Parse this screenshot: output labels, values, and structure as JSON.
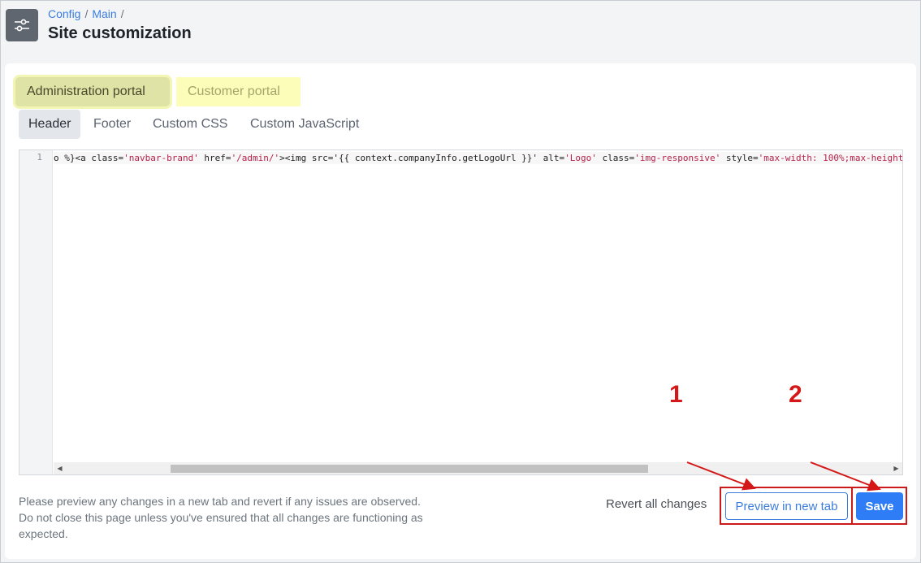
{
  "breadcrumb": {
    "items": [
      "Config",
      "Main"
    ],
    "separator": "/"
  },
  "page_title": "Site customization",
  "portal_tabs": [
    {
      "label": "Administration portal",
      "active": true
    },
    {
      "label": "Customer portal",
      "active": false
    }
  ],
  "section_tabs": [
    {
      "label": "Header",
      "active": true
    },
    {
      "label": "Footer",
      "active": false
    },
    {
      "label": "Custom CSS",
      "active": false
    },
    {
      "label": "Custom JavaScript",
      "active": false
    }
  ],
  "editor": {
    "line_number": "1",
    "code": {
      "p1": "o %}<a class=",
      "s1": "'navbar-brand'",
      "p2": " href=",
      "s2": "'/admin/'",
      "p3": "><img src='{{ context.companyInfo.getLogoUrl }}' alt=",
      "s3": "'Logo'",
      "p4": " class=",
      "s4": "'img-responsive'",
      "p5": " style=",
      "s5": "'max-width: 100%;max-height"
    }
  },
  "footer": {
    "note_lines": [
      "Please preview any changes in a new tab and revert if any issues are observed.",
      "Do not close this page unless you've ensured that all changes are functioning as",
      "expected."
    ],
    "revert_label": "Revert all changes",
    "preview_label": "Preview in new tab",
    "save_label": "Save"
  },
  "annotations": {
    "first": "1",
    "second": "2",
    "color": "#d41818"
  },
  "colors": {
    "accent": "#3b7ddd",
    "save_button": "#2f7df6",
    "admin_tab_highlight": "#dfe3a6",
    "customer_tab_highlight": "#fbfdb8"
  }
}
